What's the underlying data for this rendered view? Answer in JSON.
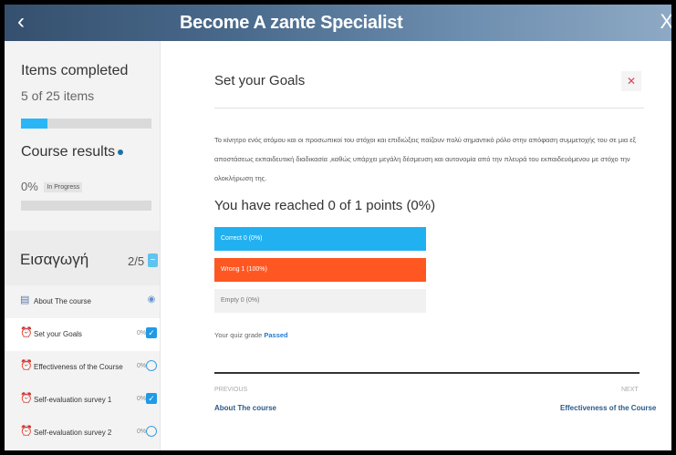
{
  "header": {
    "back_icon": "‹",
    "title": "Become A zante Specialist",
    "close_icon": "X"
  },
  "sidebar": {
    "items_title": "Items completed",
    "items_count": "5 of 25 items",
    "items_progress": 0.2,
    "results_title": "Course results",
    "results_value": "0%",
    "results_badge": "In Progress",
    "section": {
      "name": "Εισαγωγή",
      "count": "2/5",
      "toggle": "−"
    },
    "lessons": [
      {
        "label": "About The course",
        "pct": "",
        "status": "eye"
      },
      {
        "label": "Set your Goals",
        "pct": "0%",
        "status": "check"
      },
      {
        "label": "Effectiveness of the Course",
        "pct": "0%",
        "status": "ring"
      },
      {
        "label": "Self-evaluation survey 1",
        "pct": "0%",
        "status": "check"
      },
      {
        "label": "Self-evaluation survey 2",
        "pct": "0%",
        "status": "ring"
      }
    ]
  },
  "main": {
    "title": "Set your Goals",
    "close_icon": "✕",
    "description": "Το κίνητρο ενός ατόμου και οι προσωπικοί του στόχοι και επιδιώξεις παίζουν πολύ σημαντικό ρόλο στην απόφαση συμμετοχής του σε μια εξ αποστάσεως εκπαιδευτική διαδικασία ,καθώς υπάρχει μεγάλη δέσμευση και αυτονομία από την πλευρά του εκπαιδευόμενου με στόχο την ολοκλήρωση της.",
    "score": "You have reached 0 of 1 points (0%)",
    "correct": "Correct 0 (0%)",
    "wrong": "Wrong 1 (100%)",
    "empty": "Empty 0 (0%)",
    "grade_label": "Your quiz grade",
    "grade_value": "Passed",
    "prev_caption": "PREVIOUS",
    "prev_link": "About The course",
    "next_caption": "NEXT",
    "next_link": "Effectiveness of the Course"
  },
  "colors": {
    "accent": "#29b6f6",
    "wrong": "#ff5722",
    "link": "#2a5b8a"
  }
}
